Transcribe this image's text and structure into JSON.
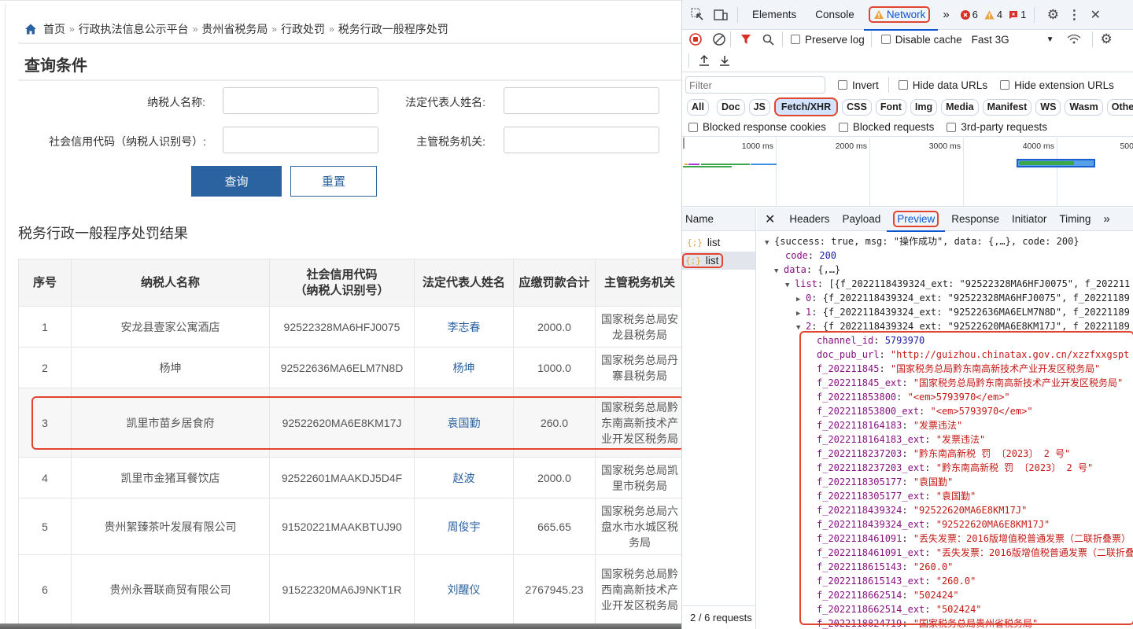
{
  "page": {
    "breadcrumb": [
      "首页",
      "行政执法信息公示平台",
      "贵州省税务局",
      "行政处罚",
      "税务行政一般程序处罚"
    ],
    "breadcrumb_sep": "»",
    "query_title": "查询条件",
    "form": {
      "taxpayer_name_label": "纳税人名称:",
      "legal_rep_label": "法定代表人姓名:",
      "credit_code_label": "社会信用代码（纳税人识别号）:",
      "tax_authority_label": "主管税务机关:",
      "taxpayer_name_value": "",
      "legal_rep_value": "",
      "credit_code_value": "",
      "tax_authority_value": ""
    },
    "buttons": {
      "query": "查询",
      "reset": "重置"
    },
    "result_title": "税务行政一般程序处罚结果",
    "table": {
      "headers": [
        "序号",
        "纳税人名称",
        "社会信用代码\n（纳税人识别号）",
        "法定代表人姓名",
        "应缴罚款合计",
        "主管税务机关"
      ],
      "rows": [
        {
          "no": "1",
          "name": "安龙县壹家公寓酒店",
          "code": "92522328MA6HFJ0075",
          "rep": "李志春",
          "amount": "2000.0",
          "authority": "国家税务总局安龙县税务局"
        },
        {
          "no": "2",
          "name": "杨坤",
          "code": "92522636MA6ELM7N8D",
          "rep": "杨坤",
          "amount": "1000.0",
          "authority": "国家税务总局丹寨县税务局"
        },
        {
          "no": "3",
          "name": "凯里市苗乡居食府",
          "code": "92522620MA6E8KM17J",
          "rep": "袁国勤",
          "amount": "260.0",
          "authority": "国家税务总局黔东南高新技术产业开发区税务局"
        },
        {
          "no": "4",
          "name": "凯里市金猪耳餐饮店",
          "code": "92522601MAAKDJ5D4F",
          "rep": "赵波",
          "amount": "2000.0",
          "authority": "国家税务总局凯里市税务局"
        },
        {
          "no": "5",
          "name": "贵州絮臻茶叶发展有限公司",
          "code": "91520221MAAKBTUJ90",
          "rep": "周俊宇",
          "amount": "665.65",
          "authority": "国家税务总局六盘水市水城区税务局"
        },
        {
          "no": "6",
          "name": "贵州永晋联商贸有限公司",
          "code": "91522320MA6J9NKT1R",
          "rep": "刘醒仪",
          "amount": "2767945.23",
          "authority": "国家税务总局黔西南高新技术产业开发区税务局"
        }
      ],
      "highlighted_row": 3
    }
  },
  "devtools": {
    "tabs": [
      "Elements",
      "Console",
      "Network"
    ],
    "active_tab": "Network",
    "more_tabs": "»",
    "counts": {
      "errors": "6",
      "warnings": "4",
      "issues": "1"
    },
    "toolbar": {
      "preserve_log": "Preserve log",
      "disable_cache": "Disable cache",
      "throttle": "Fast 3G"
    },
    "filter": {
      "placeholder": "Filter",
      "invert": "Invert",
      "hide_data_urls": "Hide data URLs",
      "hide_extension_urls": "Hide extension URLs"
    },
    "types": [
      "All",
      "Doc",
      "JS",
      "Fetch/XHR",
      "CSS",
      "Font",
      "Img",
      "Media",
      "Manifest",
      "WS",
      "Wasm",
      "Other"
    ],
    "selected_type": "Fetch/XHR",
    "blocked": {
      "cookies": "Blocked response cookies",
      "requests": "Blocked requests",
      "third_party": "3rd-party requests"
    },
    "timeline_labels": [
      "1000 ms",
      "2000 ms",
      "3000 ms",
      "4000 ms",
      "500"
    ],
    "requests": {
      "header": "Name",
      "items": [
        "list",
        "list"
      ],
      "selected_index": 1,
      "footer": "2 / 6 requests"
    },
    "detail_tabs": [
      "Headers",
      "Payload",
      "Preview",
      "Response",
      "Initiator",
      "Timing"
    ],
    "active_detail_tab": "Preview",
    "preview": {
      "root": "{success: true, msg: \"操作成功\", data: {,…}, code: 200}",
      "code_key": "code",
      "code_val": "200",
      "data_key": "data",
      "data_val": "{,…}",
      "list_key": "list",
      "list_val": "[{f_2022118439324_ext: \"92522328MA6HFJ0075\", f_202211",
      "items": [
        {
          "idx": "0",
          "summary": "{f_2022118439324_ext: \"92522328MA6HFJ0075\", f_20221189",
          "expanded": false
        },
        {
          "idx": "1",
          "summary": "{f_2022118439324_ext: \"92522636MA6ELM7N8D\", f_20221189",
          "expanded": false
        },
        {
          "idx": "2",
          "summary": "{f_2022118439324_ext: \"92522620MA6E8KM17J\", f_20221189",
          "expanded": true
        }
      ],
      "fields": [
        {
          "k": "channel_id",
          "v": "5793970",
          "t": "n"
        },
        {
          "k": "doc_pub_url",
          "v": "\"http://guizhou.chinatax.gov.cn/xzzfxxgspt",
          "t": "s"
        },
        {
          "k": "f_202211845",
          "v": "\"国家税务总局黔东南高新技术产业开发区税务局\"",
          "t": "s"
        },
        {
          "k": "f_202211845_ext",
          "v": "\"国家税务总局黔东南高新技术产业开发区税务局\"",
          "t": "s"
        },
        {
          "k": "f_202211853800",
          "v": "\"<em>5793970</em>\"",
          "t": "s"
        },
        {
          "k": "f_202211853800_ext",
          "v": "\"<em>5793970</em>\"",
          "t": "s"
        },
        {
          "k": "f_2022118164183",
          "v": "\"发票违法\"",
          "t": "s"
        },
        {
          "k": "f_2022118164183_ext",
          "v": "\"发票违法\"",
          "t": "s"
        },
        {
          "k": "f_2022118237203",
          "v": "\"黔东南高新税 罚 〔2023〕 2 号\"",
          "t": "s"
        },
        {
          "k": "f_2022118237203_ext",
          "v": "\"黔东南高新税 罚 〔2023〕 2 号\"",
          "t": "s"
        },
        {
          "k": "f_2022118305177",
          "v": "\"袁国勤\"",
          "t": "s"
        },
        {
          "k": "f_2022118305177_ext",
          "v": "\"袁国勤\"",
          "t": "s"
        },
        {
          "k": "f_2022118439324",
          "v": "\"92522620MA6E8KM17J\"",
          "t": "s"
        },
        {
          "k": "f_2022118439324_ext",
          "v": "\"92522620MA6E8KM17J\"",
          "t": "s"
        },
        {
          "k": "f_2022118461091",
          "v": "\"丢失发票：2016版增值税普通发票（二联折叠票）",
          "t": "s"
        },
        {
          "k": "f_2022118461091_ext",
          "v": "\"丢失发票：2016版增值税普通发票（二联折叠",
          "t": "s"
        },
        {
          "k": "f_2022118615143",
          "v": "\"260.0\"",
          "t": "s"
        },
        {
          "k": "f_2022118615143_ext",
          "v": "\"260.0\"",
          "t": "s"
        },
        {
          "k": "f_2022118662514",
          "v": "\"502424\"",
          "t": "s"
        },
        {
          "k": "f_2022118662514_ext",
          "v": "\"502424\"",
          "t": "s"
        },
        {
          "k": "f_2022118824719",
          "v": "\"国家税务总局贵州省税务局\"",
          "t": "s"
        }
      ]
    }
  }
}
